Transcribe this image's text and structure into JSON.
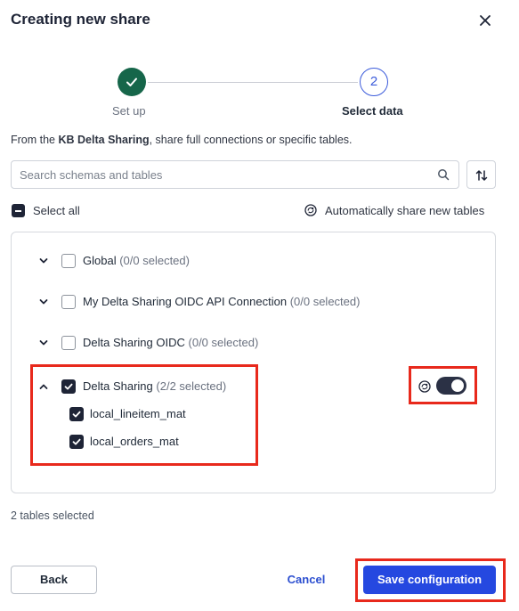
{
  "dialog": {
    "title": "Creating new share"
  },
  "stepper": {
    "steps": [
      {
        "label": "Set up",
        "status": "complete"
      },
      {
        "label": "Select data",
        "number": "2",
        "status": "current"
      }
    ]
  },
  "intro": {
    "prefix": "From the ",
    "source": "KB Delta Sharing",
    "suffix": ", share full connections or specific tables."
  },
  "search": {
    "placeholder": "Search schemas and tables",
    "value": ""
  },
  "select_all": {
    "label": "Select all",
    "state": "indeterminate"
  },
  "auto_share": {
    "label": "Automatically share new tables"
  },
  "connections": [
    {
      "name": "Global",
      "count": "(0/0 selected)",
      "expanded": false,
      "checked": false
    },
    {
      "name": "My Delta Sharing OIDC API Connection",
      "count": "(0/0 selected)",
      "expanded": false,
      "checked": false
    },
    {
      "name": "Delta Sharing OIDC",
      "count": "(0/0 selected)",
      "expanded": false,
      "checked": false
    },
    {
      "name": "Delta Sharing",
      "count": "(2/2 selected)",
      "expanded": true,
      "checked": true,
      "auto_share_enabled": true,
      "tables": [
        {
          "name": "local_lineitem_mat",
          "checked": true
        },
        {
          "name": "local_orders_mat",
          "checked": true
        }
      ]
    }
  ],
  "footer": {
    "selected_summary": "2 tables selected",
    "back_label": "Back",
    "cancel_label": "Cancel",
    "save_label": "Save configuration"
  },
  "colors": {
    "primary": "#2548e0",
    "step_complete": "#16664a",
    "checkbox_checked": "#1e2436",
    "highlight": "#e8291c"
  }
}
